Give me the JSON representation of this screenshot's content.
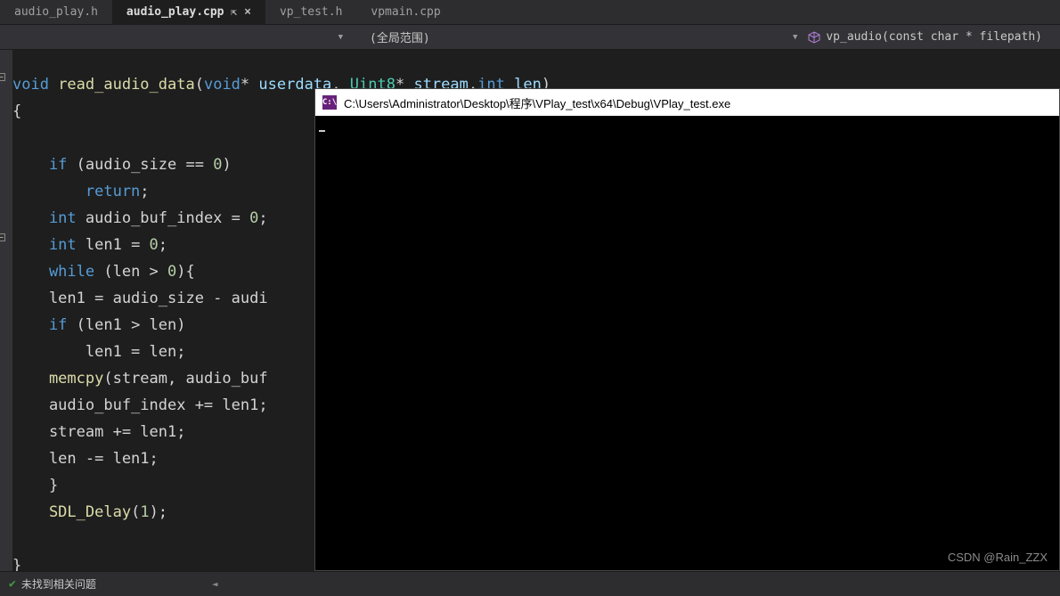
{
  "tabs": [
    {
      "label": "audio_play.h"
    },
    {
      "label": "audio_play.cpp",
      "active": true
    },
    {
      "label": "vp_test.h"
    },
    {
      "label": "vpmain.cpp"
    }
  ],
  "navbar": {
    "scope": "(全局范围)",
    "symbol": "vp_audio(const char * filepath)"
  },
  "code": {
    "l1_a": "void",
    "l1_b": " read_audio_data",
    "l1_c": "(",
    "l1_d": "void",
    "l1_e": "* ",
    "l1_f": "userdata",
    "l1_g": ", ",
    "l1_h": "Uint8",
    "l1_i": "* ",
    "l1_j": "stream",
    "l1_k": ",",
    "l1_l": "int",
    "l1_m": " ",
    "l1_n": "len",
    "l1_o": ")",
    "l2": "{",
    "l3_a": "    if",
    "l3_b": " (audio_size == ",
    "l3_c": "0",
    "l3_d": ")",
    "l4_a": "        return",
    "l4_b": ";",
    "l5_a": "    int",
    "l5_b": " audio_buf_index = ",
    "l5_c": "0",
    "l5_d": ";",
    "l6_a": "    int",
    "l6_b": " len1 = ",
    "l6_c": "0",
    "l6_d": ";",
    "l7_a": "    while",
    "l7_b": " (len > ",
    "l7_c": "0",
    "l7_d": "){",
    "l8": "    len1 = audio_size - audi",
    "l9_a": "    if",
    "l9_b": " (len1 > len)",
    "l10": "        len1 = len;",
    "l11_a": "    memcpy",
    "l11_b": "(stream, audio_buf",
    "l12": "    audio_buf_index += len1;",
    "l13": "    stream += len1;",
    "l14": "    len -= len1;",
    "l15": "    }",
    "l16_a": "    SDL_Delay",
    "l16_b": "(",
    "l16_c": "1",
    "l16_d": ");",
    "l18": "}"
  },
  "console": {
    "icon_text": "C:\\",
    "title": "C:\\Users\\Administrator\\Desktop\\程序\\VPlay_test\\x64\\Debug\\VPlay_test.exe"
  },
  "statusbar": {
    "message": "未找到相关问题",
    "scroll_glyph": "◄"
  },
  "watermark": "CSDN @Rain_ZZX"
}
